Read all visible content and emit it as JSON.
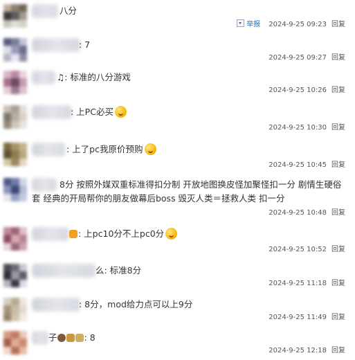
{
  "comments": [
    {
      "text": "八分",
      "time": "2024-9-25 09:23",
      "reply": "回复",
      "report": "举报"
    },
    {
      "text": ": 7",
      "time": "2024-9-25 09:27",
      "reply": "回复"
    },
    {
      "text": "♫: 标准的八分游戏",
      "time": "2024-9-25 10:26",
      "reply": "回复"
    },
    {
      "text": ": 上PC必买",
      "time": "2024-9-25 10:30",
      "reply": "回复"
    },
    {
      "text": ": 上了pc我原价预购",
      "time": "2024-9-25 10:45",
      "reply": "回复"
    },
    {
      "text": "8分 按照外媒双重标准得扣分制 开放地图换皮怪加聚怪扣一分 剧情生硬俗套 经典的开局帮你的朋友做幕后boss 毁灭人类＝拯救人类 扣一分",
      "time": "2024-9-25 10:48",
      "reply": "回复"
    },
    {
      "text": ": 上pc10分不上pc0分",
      "time": "2024-9-25 10:52",
      "reply": "回复"
    },
    {
      "text": "么: 标准8分",
      "time": "2024-9-25 11:18",
      "reply": "回复"
    },
    {
      "text": ": 8分，mod给力点可以上9分",
      "time": "2024-9-25 11:49",
      "reply": "回复"
    },
    {
      "text": "子",
      "text_tail": ": 8",
      "time": "2024-9-25 12:18",
      "reply": "回复"
    }
  ],
  "colors": {
    "report_link": "#2e6fb7",
    "meta_text": "#555555",
    "separator": "#ececec"
  }
}
